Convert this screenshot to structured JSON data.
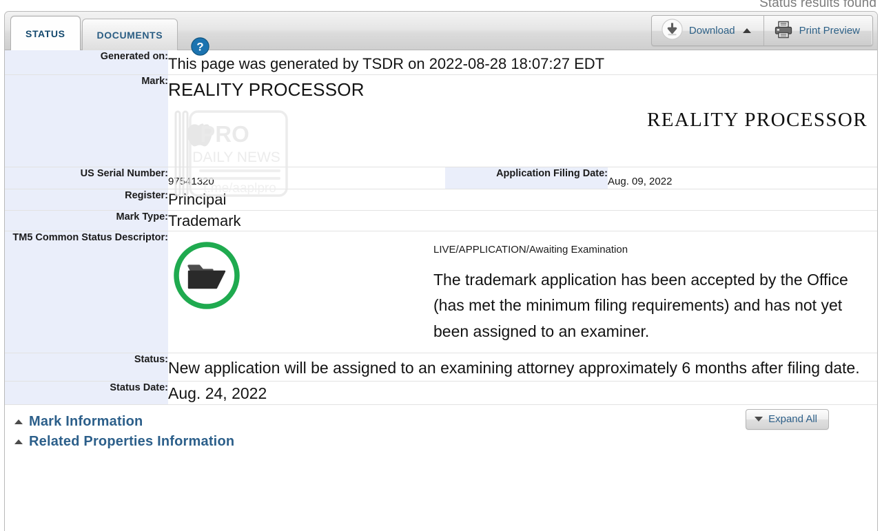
{
  "banner": {
    "cutoff_text": "Status results found"
  },
  "tabs": [
    {
      "label": "STATUS",
      "active": true
    },
    {
      "label": "DOCUMENTS",
      "active": false
    }
  ],
  "icons": {
    "help": "help-circle-icon",
    "download": "download-circle-icon",
    "print": "printer-icon",
    "caret_up": "caret-up-icon",
    "caret_down": "caret-down-icon"
  },
  "toolbar": {
    "download_label": "Download",
    "print_preview_label": "Print Preview"
  },
  "rows": {
    "generated_on_label": "Generated on:",
    "generated_on_value": "This page was generated by TSDR on 2022-08-28 18:07:27 EDT",
    "mark_label": "Mark:",
    "mark_value": "REALITY PROCESSOR",
    "mark_image_text": "REALITY PROCESSOR",
    "serial_label": "US Serial Number:",
    "serial_value": "97541320",
    "filing_date_label": "Application Filing Date:",
    "filing_date_value": "Aug. 09, 2022",
    "register_label": "Register:",
    "register_value": "Principal",
    "mark_type_label": "Mark Type:",
    "mark_type_value": "Trademark",
    "tm5_label": "TM5 Common Status Descriptor:",
    "tm5_status_line": "LIVE/APPLICATION/Awaiting Examination",
    "tm5_description": "The trademark application has been accepted by the Office (has met the minimum filing requirements) and has not yet been assigned to an examiner.",
    "status_label": "Status:",
    "status_value": "New application will be assigned to an examining attorney approximately 6 months after filing date.",
    "status_date_label": "Status Date:",
    "status_date_value": "Aug. 24, 2022"
  },
  "accordion": {
    "expand_all_label": "Expand All",
    "sections": [
      {
        "label": "Mark Information",
        "expanded": true
      },
      {
        "label": "Related Properties Information",
        "expanded": false
      }
    ]
  },
  "watermark": {
    "brand": "PRO",
    "subtitle": "DAILY NEWS",
    "handle": "t.me/aaplpro"
  },
  "colors": {
    "label_bg": "#eaeefa",
    "link_blue": "#2c5f8a",
    "tab_text": "#14496e",
    "status_green": "#1faa4f",
    "help_blue": "#1b73b0"
  }
}
